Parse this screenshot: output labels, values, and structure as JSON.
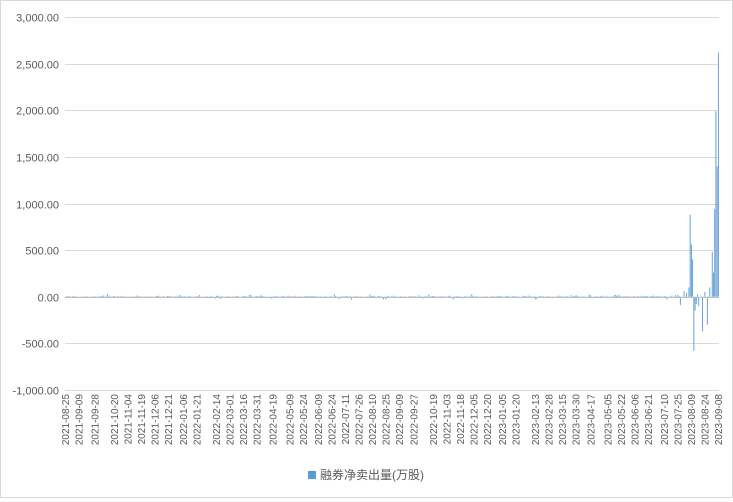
{
  "chart_data": {
    "type": "bar",
    "title": "",
    "xlabel": "",
    "ylabel": "",
    "ylim": [
      -1000,
      3000
    ],
    "yticks": [
      3000,
      2500,
      2000,
      1500,
      1000,
      500,
      0,
      -500,
      -1000
    ],
    "ytick_labels": [
      "3,000.00",
      "2,500.00",
      "2,000.00",
      "1,500.00",
      "1,000.00",
      "500.00",
      "0.00",
      "-500.00",
      "-1,000.00"
    ],
    "x_tick_labels": [
      "2021-08-25",
      "2021-09-09",
      "2021-09-28",
      "2021-10-20",
      "2021-11-04",
      "2021-11-19",
      "2021-12-06",
      "2021-12-21",
      "2022-01-06",
      "2022-01-21",
      "2022-02-14",
      "2022-03-01",
      "2022-03-16",
      "2022-03-31",
      "2022-04-19",
      "2022-05-09",
      "2022-05-24",
      "2022-06-09",
      "2022-06-24",
      "2022-07-11",
      "2022-07-26",
      "2022-08-10",
      "2022-08-25",
      "2022-09-09",
      "2022-09-27",
      "2022-10-19",
      "2022-11-03",
      "2022-11-18",
      "2022-12-05",
      "2022-12-20",
      "2023-01-05",
      "2023-01-20",
      "2023-02-13",
      "2023-02-28",
      "2023-03-15",
      "2023-03-30",
      "2023-04-17",
      "2023-05-05",
      "2023-05-22",
      "2023-06-06",
      "2023-06-21",
      "2023-07-10",
      "2023-07-25",
      "2023-08-09",
      "2023-08-24",
      "2023-09-08"
    ],
    "grid": true,
    "legend_position": "bottom",
    "series": [
      {
        "name": "融券净卖出量(万股)",
        "color": "#5b9bd5",
        "baseline_noise_range": [
          -30,
          30
        ],
        "notable_points": [
          {
            "date": "2023-07-25",
            "value": 20
          },
          {
            "date": "2023-07-27",
            "value": -90
          },
          {
            "date": "2023-08-01",
            "value": 60
          },
          {
            "date": "2023-08-03",
            "value": 40
          },
          {
            "date": "2023-08-07",
            "value": 100
          },
          {
            "date": "2023-08-08",
            "value": 880
          },
          {
            "date": "2023-08-09",
            "value": 560
          },
          {
            "date": "2023-08-10",
            "value": 400
          },
          {
            "date": "2023-08-11",
            "value": -580
          },
          {
            "date": "2023-08-14",
            "value": -150
          },
          {
            "date": "2023-08-15",
            "value": -80
          },
          {
            "date": "2023-08-17",
            "value": -100
          },
          {
            "date": "2023-08-22",
            "value": -370
          },
          {
            "date": "2023-08-24",
            "value": 50
          },
          {
            "date": "2023-08-28",
            "value": -300
          },
          {
            "date": "2023-08-30",
            "value": 100
          },
          {
            "date": "2023-09-01",
            "value": 480
          },
          {
            "date": "2023-09-04",
            "value": 260
          },
          {
            "date": "2023-09-05",
            "value": 940
          },
          {
            "date": "2023-09-06",
            "value": 1990
          },
          {
            "date": "2023-09-07",
            "value": 1400
          },
          {
            "date": "2023-09-08",
            "value": 2620
          }
        ]
      }
    ]
  }
}
